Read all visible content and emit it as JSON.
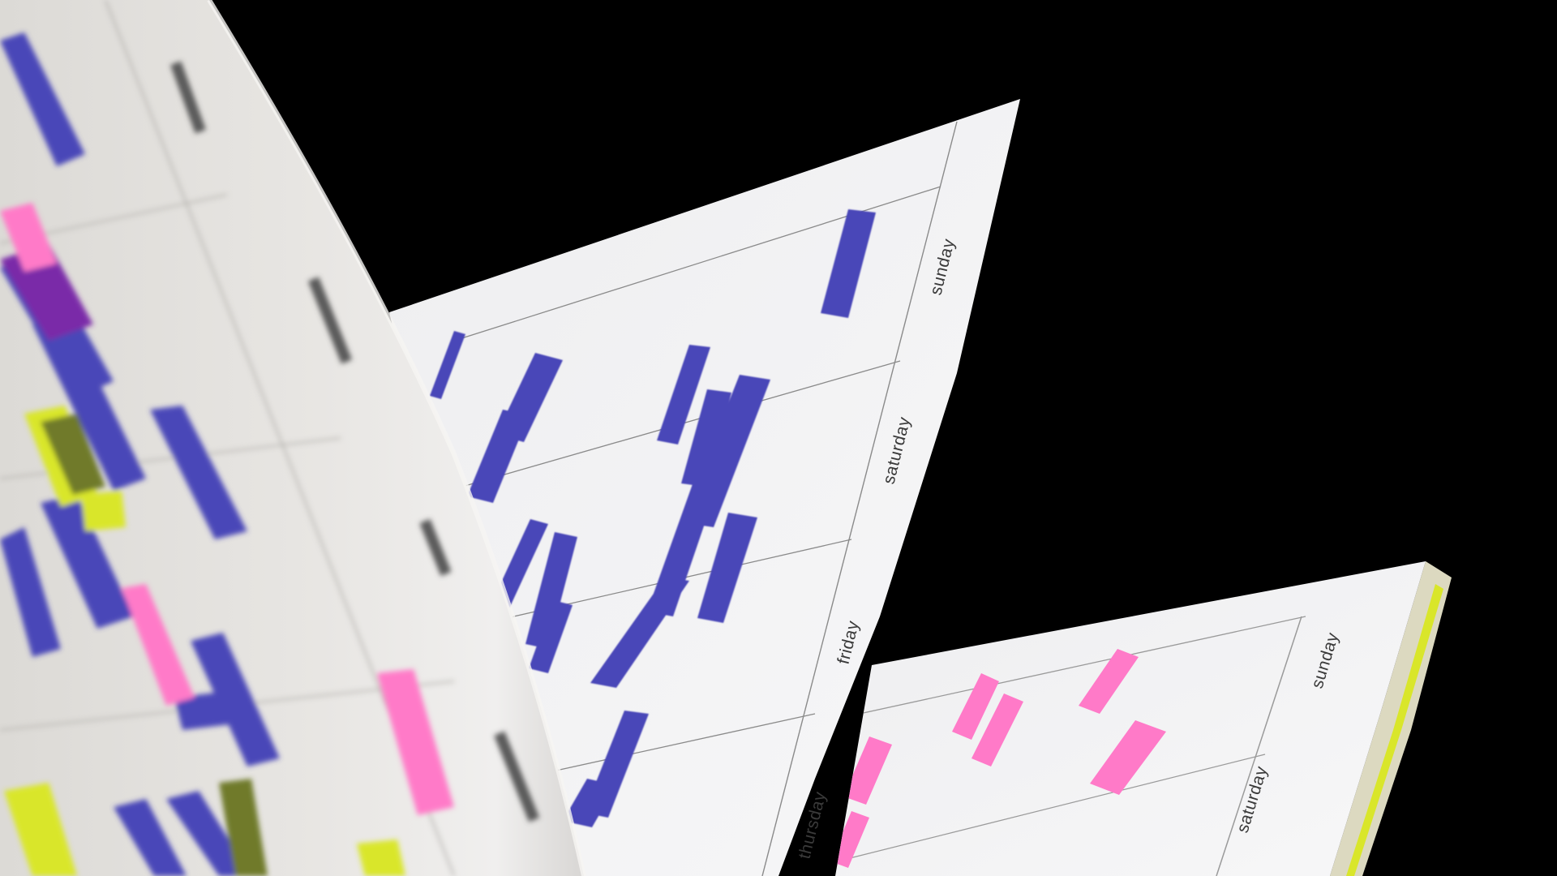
{
  "scene": {
    "background_color": "#000000",
    "paper_color": "#f4f3f5",
    "rule_color": "#8a8a8a",
    "ink_colors": {
      "blue": "#4a46b8",
      "pink": "#ff7ac8",
      "yellow": "#d9e62a"
    }
  },
  "middle_page": {
    "day_labels": [
      "sunday",
      "saturday",
      "friday",
      "thursday"
    ]
  },
  "back_page": {
    "day_labels": [
      "sunday",
      "saturday"
    ]
  }
}
